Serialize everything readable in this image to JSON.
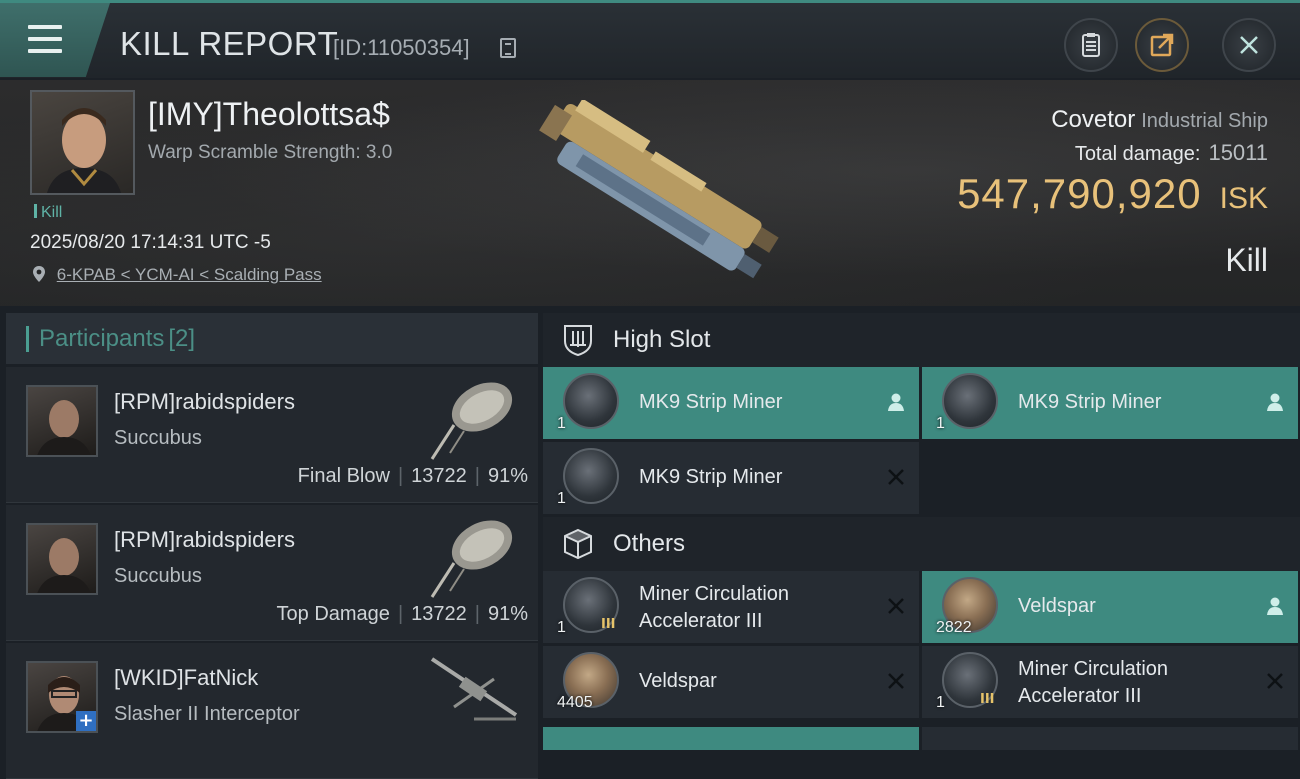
{
  "topbar": {
    "title": "KILL REPORT",
    "report_id": "[ID:11050354]",
    "icons": [
      "menu-icon",
      "copy-icon",
      "clipboard-icon",
      "share-icon",
      "close-icon"
    ]
  },
  "victim": {
    "name": "[IMY]Theolottsa$",
    "warp_scramble": "Warp Scramble Strength: 3.0",
    "kill_tag": "Kill",
    "timestamp": "2025/08/20 17:14:31 UTC -5",
    "location": "6-KPAB < YCM-AI < Scalding Pass",
    "ship_name": "Covetor",
    "ship_class": "Industrial Ship",
    "total_damage_label": "Total damage:",
    "total_damage": "15011",
    "isk_value": "547,790,920",
    "isk_unit": "ISK",
    "result": "Kill"
  },
  "participants": {
    "title": "Participants",
    "count": "[2]",
    "rows": [
      {
        "name": "[RPM]rabidspiders",
        "ship": "Succubus",
        "tag": "Final Blow",
        "damage": "13722",
        "percent": "91%"
      },
      {
        "name": "[RPM]rabidspiders",
        "ship": "Succubus",
        "tag": "Top Damage",
        "damage": "13722",
        "percent": "91%"
      },
      {
        "name": "[WKID]FatNick",
        "ship": "Slasher II Interceptor",
        "tag": "",
        "damage": "",
        "percent": ""
      }
    ]
  },
  "high_slot": {
    "title": "High Slot",
    "items": [
      {
        "name": "MK9 Strip Miner",
        "qty": "1",
        "state": "dropped"
      },
      {
        "name": "MK9 Strip Miner",
        "qty": "1",
        "state": "dropped"
      },
      {
        "name": "MK9 Strip Miner",
        "qty": "1",
        "state": "destroyed"
      }
    ]
  },
  "others": {
    "title": "Others",
    "items": [
      {
        "name_line1": "Miner Circulation",
        "name_line2": "Accelerator III",
        "qty": "1",
        "tier": "III",
        "state": "destroyed"
      },
      {
        "name": "Veldspar",
        "qty": "2822",
        "state": "dropped"
      },
      {
        "name": "Veldspar",
        "qty": "4405",
        "state": "destroyed"
      },
      {
        "name_line1": "Miner Circulation",
        "name_line2": "Accelerator III",
        "qty": "1",
        "tier": "III",
        "state": "destroyed"
      }
    ]
  },
  "colors": {
    "accent": "#3e8a80",
    "isk": "#e8c17a",
    "background": "#1b2026"
  }
}
